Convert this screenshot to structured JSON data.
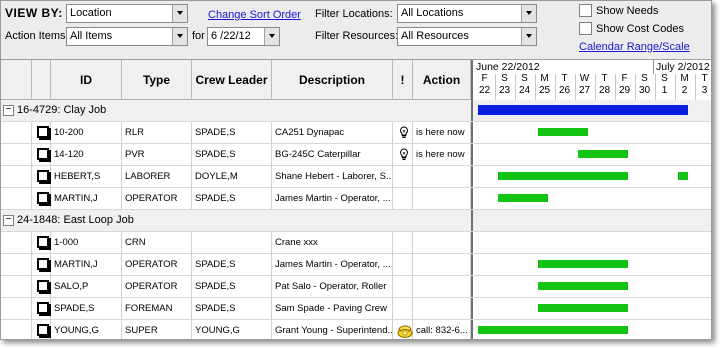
{
  "toolbar": {
    "view_by_label": "VIEW BY:",
    "view_by_value": "Location",
    "change_sort_order": "Change Sort Order",
    "filter_locations_label": "Filter Locations:",
    "filter_locations_value": "All Locations",
    "action_items_label": "Action Items:",
    "action_items_value": "All Items",
    "for_label": "for",
    "date_value": "6 /22/12",
    "filter_resources_label": "Filter Resources:",
    "filter_resources_value": "All Resources",
    "show_needs": "Show Needs",
    "show_cost_codes": "Show Cost Codes",
    "calendar_range": "Calendar Range/Scale"
  },
  "columns": {
    "id": "ID",
    "type": "Type",
    "crew_leader": "Crew Leader",
    "description": "Description",
    "flag": "!",
    "action": "Action"
  },
  "gantt": {
    "month1": "June 22/2012",
    "month2": "July 2/2012",
    "days": [
      {
        "dow": "F",
        "num": "22"
      },
      {
        "dow": "S",
        "num": "23"
      },
      {
        "dow": "S",
        "num": "24"
      },
      {
        "dow": "M",
        "num": "25"
      },
      {
        "dow": "T",
        "num": "26"
      },
      {
        "dow": "W",
        "num": "27"
      },
      {
        "dow": "T",
        "num": "28"
      },
      {
        "dow": "F",
        "num": "29"
      },
      {
        "dow": "S",
        "num": "30"
      },
      {
        "dow": "S",
        "num": "1"
      },
      {
        "dow": "M",
        "num": "2"
      },
      {
        "dow": "T",
        "num": "3"
      }
    ],
    "group_color": "#0a1ee0",
    "item_color": "#11c411"
  },
  "groups": [
    {
      "label": "16-4729: Clay Job",
      "bar": {
        "start_day": 0,
        "end_day": 10.5
      },
      "items": [
        {
          "id": "10-200",
          "type": "RLR",
          "leader": "SPADE,S",
          "desc": "CA251 Dynapac",
          "icon": "lightbulb-icon",
          "action": "is here now",
          "bars": [
            {
              "start": 3,
              "end": 5.5
            }
          ]
        },
        {
          "id": "14-120",
          "type": "PVR",
          "leader": "SPADE,S",
          "desc": "BG-245C Caterpillar",
          "icon": "lightbulb-icon",
          "action": "is here now",
          "bars": [
            {
              "start": 5,
              "end": 7.5
            }
          ]
        },
        {
          "id": "HEBERT,S",
          "type": "LABORER",
          "leader": "DOYLE,M",
          "desc": "Shane Hebert - Laborer, S...",
          "icon": "",
          "action": "",
          "bars": [
            {
              "start": 1,
              "end": 7.5
            },
            {
              "start": 10,
              "end": 10.5
            }
          ]
        },
        {
          "id": "MARTIN,J",
          "type": "OPERATOR",
          "leader": "SPADE,S",
          "desc": "James Martin - Operator, ...",
          "icon": "",
          "action": "",
          "bars": [
            {
              "start": 1,
              "end": 3.5
            }
          ]
        }
      ]
    },
    {
      "label": "24-1848: East Loop Job",
      "bar": null,
      "items": [
        {
          "id": "1-000",
          "type": "CRN",
          "leader": "",
          "desc": "Crane xxx",
          "icon": "",
          "action": "",
          "bars": []
        },
        {
          "id": "MARTIN,J",
          "type": "OPERATOR",
          "leader": "SPADE,S",
          "desc": "James Martin - Operator, ...",
          "icon": "",
          "action": "",
          "bars": [
            {
              "start": 3,
              "end": 7.5
            }
          ]
        },
        {
          "id": "SALO,P",
          "type": "OPERATOR",
          "leader": "SPADE,S",
          "desc": "Pat Salo - Operator, Roller",
          "icon": "",
          "action": "",
          "bars": [
            {
              "start": 3,
              "end": 7.5
            }
          ]
        },
        {
          "id": "SPADE,S",
          "type": "FOREMAN",
          "leader": "SPADE,S",
          "desc": "Sam Spade - Paving Crew",
          "icon": "",
          "action": "",
          "bars": [
            {
              "start": 3,
              "end": 7.5
            }
          ]
        },
        {
          "id": "YOUNG,G",
          "type": "SUPER",
          "leader": "YOUNG,G",
          "desc": "Grant Young - Superintend...",
          "icon": "phone-icon",
          "action": "call: 832-6...",
          "bars": [
            {
              "start": 0,
              "end": 7.5
            }
          ]
        }
      ]
    }
  ]
}
